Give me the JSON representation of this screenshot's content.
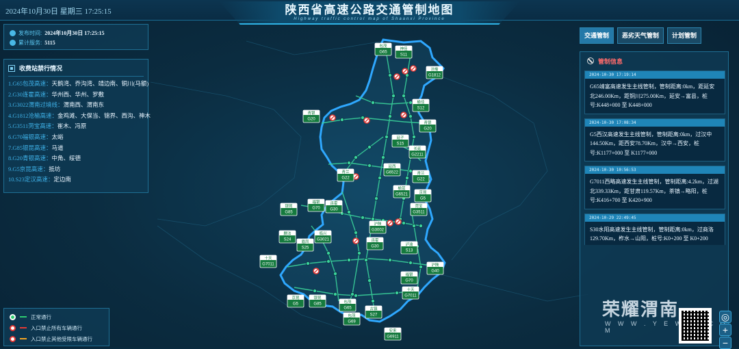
{
  "header": {
    "datetime": "2024年10月30日 星期三  17:25:15",
    "title": "陕西省高速公路交通管制地图",
    "subtitle": "Highway traffic control map of Shaanxi Province"
  },
  "info": {
    "publish_label": "发布时间:",
    "publish_value": "2024年10月30日  17:25:15",
    "service_label": "累计服务:",
    "service_value": "5115"
  },
  "toll": {
    "title": "收费站禁行情况",
    "items": [
      {
        "hw": "1.G65包茂高速：",
        "st": "天鹅湾、乔沟湾、靖边南、铜川(马额)"
      },
      {
        "hw": "2.G30连霍高速：",
        "st": "华州西、华州、罗敷"
      },
      {
        "hw": "3.G3022渭南过境线：",
        "st": "渭南西、渭南东"
      },
      {
        "hw": "4.G1812沧榆高速：",
        "st": "金鸡滩、大保当、锦界、西沟、神木"
      },
      {
        "hw": "5.G3511菏宝高速：",
        "st": "崔木、冯原"
      },
      {
        "hw": "6.G70福银高速：",
        "st": "太峪"
      },
      {
        "hw": "7.G85银昆高速：",
        "st": "马道"
      },
      {
        "hw": "8.G20青银高速：",
        "st": "中角、绥德"
      },
      {
        "hw": "9.G5京昆高速：",
        "st": "抵坊"
      },
      {
        "hw": "10.S23定汉高速：",
        "st": "定边南"
      }
    ]
  },
  "legend": {
    "items": [
      "正常通行",
      "入口禁止所有车辆通行",
      "入口禁止其他受限车辆通行"
    ],
    "colors": [
      "#2ecc71",
      "#e53935",
      "#f5a623"
    ]
  },
  "tabs": [
    "交通管制",
    "恶劣天气管制",
    "计划管制"
  ],
  "control": {
    "title": "管制信息",
    "cards": [
      {
        "time": "2024-10-30 17:19:14",
        "text": "G65靖富高速发生主线管制，管制距离:0km，距延安北246.00Km，距铜川275.00Km，延安→富县，桩号:K448+000 至 K448+000"
      },
      {
        "time": "2024-10-30 17:08:34",
        "text": "G5西汉高速发生主线管制，管制距离:0km，过汉中144.50Km，距西安78.70Km，汉中→西安，桩号:K1177+000 至 K1177+000"
      },
      {
        "time": "2024-10-30 10:56:53",
        "text": "G7011西略高速发生主线管制，管制距离:4.2km，过湖北339.33Km，距甘肃119.57Km，茶镇→略阳，桩号:K416+700 至 K420+900"
      },
      {
        "time": "2024-10-29 22:49:45",
        "text": "S30水阳高速发生主线管制，管制距离:0km，过商洛129.70Km，柞水→山阳，桩号:K0+200 至 K0+200"
      }
    ]
  },
  "map": {
    "signs": [
      {
        "name": "包茂",
        "code": "G65"
      },
      {
        "name": "神佳",
        "code": "S11"
      },
      {
        "name": "沧榆",
        "code": "G1812"
      },
      {
        "name": "榆佳",
        "code": "S12"
      },
      {
        "name": "青银",
        "code": "G20"
      },
      {
        "name": "青银",
        "code": "G20"
      },
      {
        "name": "延子",
        "code": "S15"
      },
      {
        "name": "长延",
        "code": "G2211"
      },
      {
        "name": "青兰",
        "code": "G22"
      },
      {
        "name": "延西",
        "code": "G6522"
      },
      {
        "name": "青兰",
        "code": "G22"
      },
      {
        "name": "榆蓝",
        "code": "G6521"
      },
      {
        "name": "京昆",
        "code": "G5"
      },
      {
        "name": "菏宝",
        "code": "G3511"
      },
      {
        "name": "银昆",
        "code": "G85"
      },
      {
        "name": "福银",
        "code": "G70"
      },
      {
        "name": "连霍",
        "code": "G30"
      },
      {
        "name": "麟法",
        "code": "S24"
      },
      {
        "name": "临兴",
        "code": "G3021"
      },
      {
        "name": "沪陕",
        "code": "G3002"
      },
      {
        "name": "连霍",
        "code": "G30"
      },
      {
        "name": "眉凤",
        "code": "S25"
      },
      {
        "name": "泸渝",
        "code": "S13"
      },
      {
        "name": "十天",
        "code": "G7011"
      },
      {
        "name": "沪陕",
        "code": "G40"
      },
      {
        "name": "福银",
        "code": "G70"
      },
      {
        "name": "十天",
        "code": "G7011"
      },
      {
        "name": "京昆",
        "code": "G5"
      },
      {
        "name": "银昆",
        "code": "G85"
      },
      {
        "name": "包茂",
        "code": "G65"
      },
      {
        "name": "古镇",
        "code": "S27"
      },
      {
        "name": "包茂",
        "code": "G69"
      },
      {
        "name": "安来",
        "code": "G6911"
      }
    ]
  },
  "brand": {
    "name": "荣耀渭南",
    "url": "W W W . Y E W N . C O M"
  },
  "zoom": {
    "locate": "◎",
    "plus": "+",
    "minus": "−"
  }
}
